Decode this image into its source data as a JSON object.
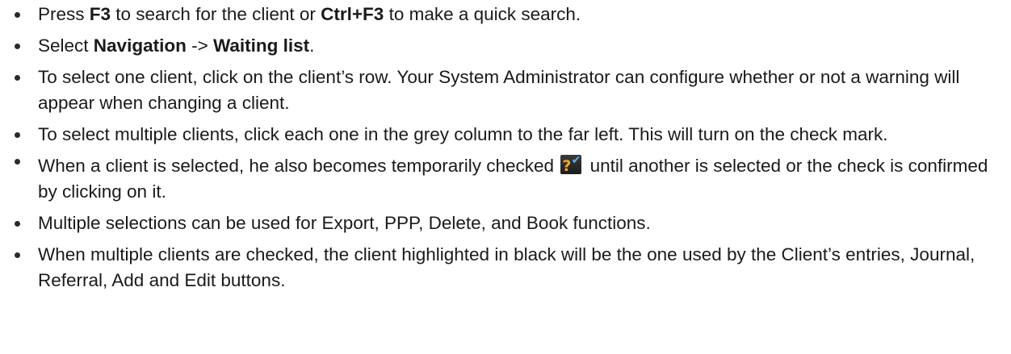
{
  "items": [
    {
      "parts": [
        "Press ",
        "F3",
        " to search for the client or ",
        "Ctrl+F3",
        " to make a quick search."
      ]
    },
    {
      "parts": [
        "Select ",
        "Navigation",
        " -> ",
        "Waiting list",
        "."
      ]
    },
    {
      "text": "To select one client, click on the client’s row. Your System Administrator can configure whether or not a warning will appear when changing a client."
    },
    {
      "text": "To select multiple clients, click each one in the grey column to the far left. This will turn on the check mark."
    },
    {
      "before_icon": "When a client is selected, he also becomes temporarily checked",
      "icon": "question-check-icon",
      "after_icon": "until another is selected or the check is confirmed by clicking on it."
    },
    {
      "text": "Multiple selections can be used for Export, PPP, Delete, and Book functions."
    },
    {
      "text": "When multiple clients are checked, the client highlighted in black will be the one used by the Client’s entries, Journal, Referral, Add and Edit buttons."
    }
  ]
}
